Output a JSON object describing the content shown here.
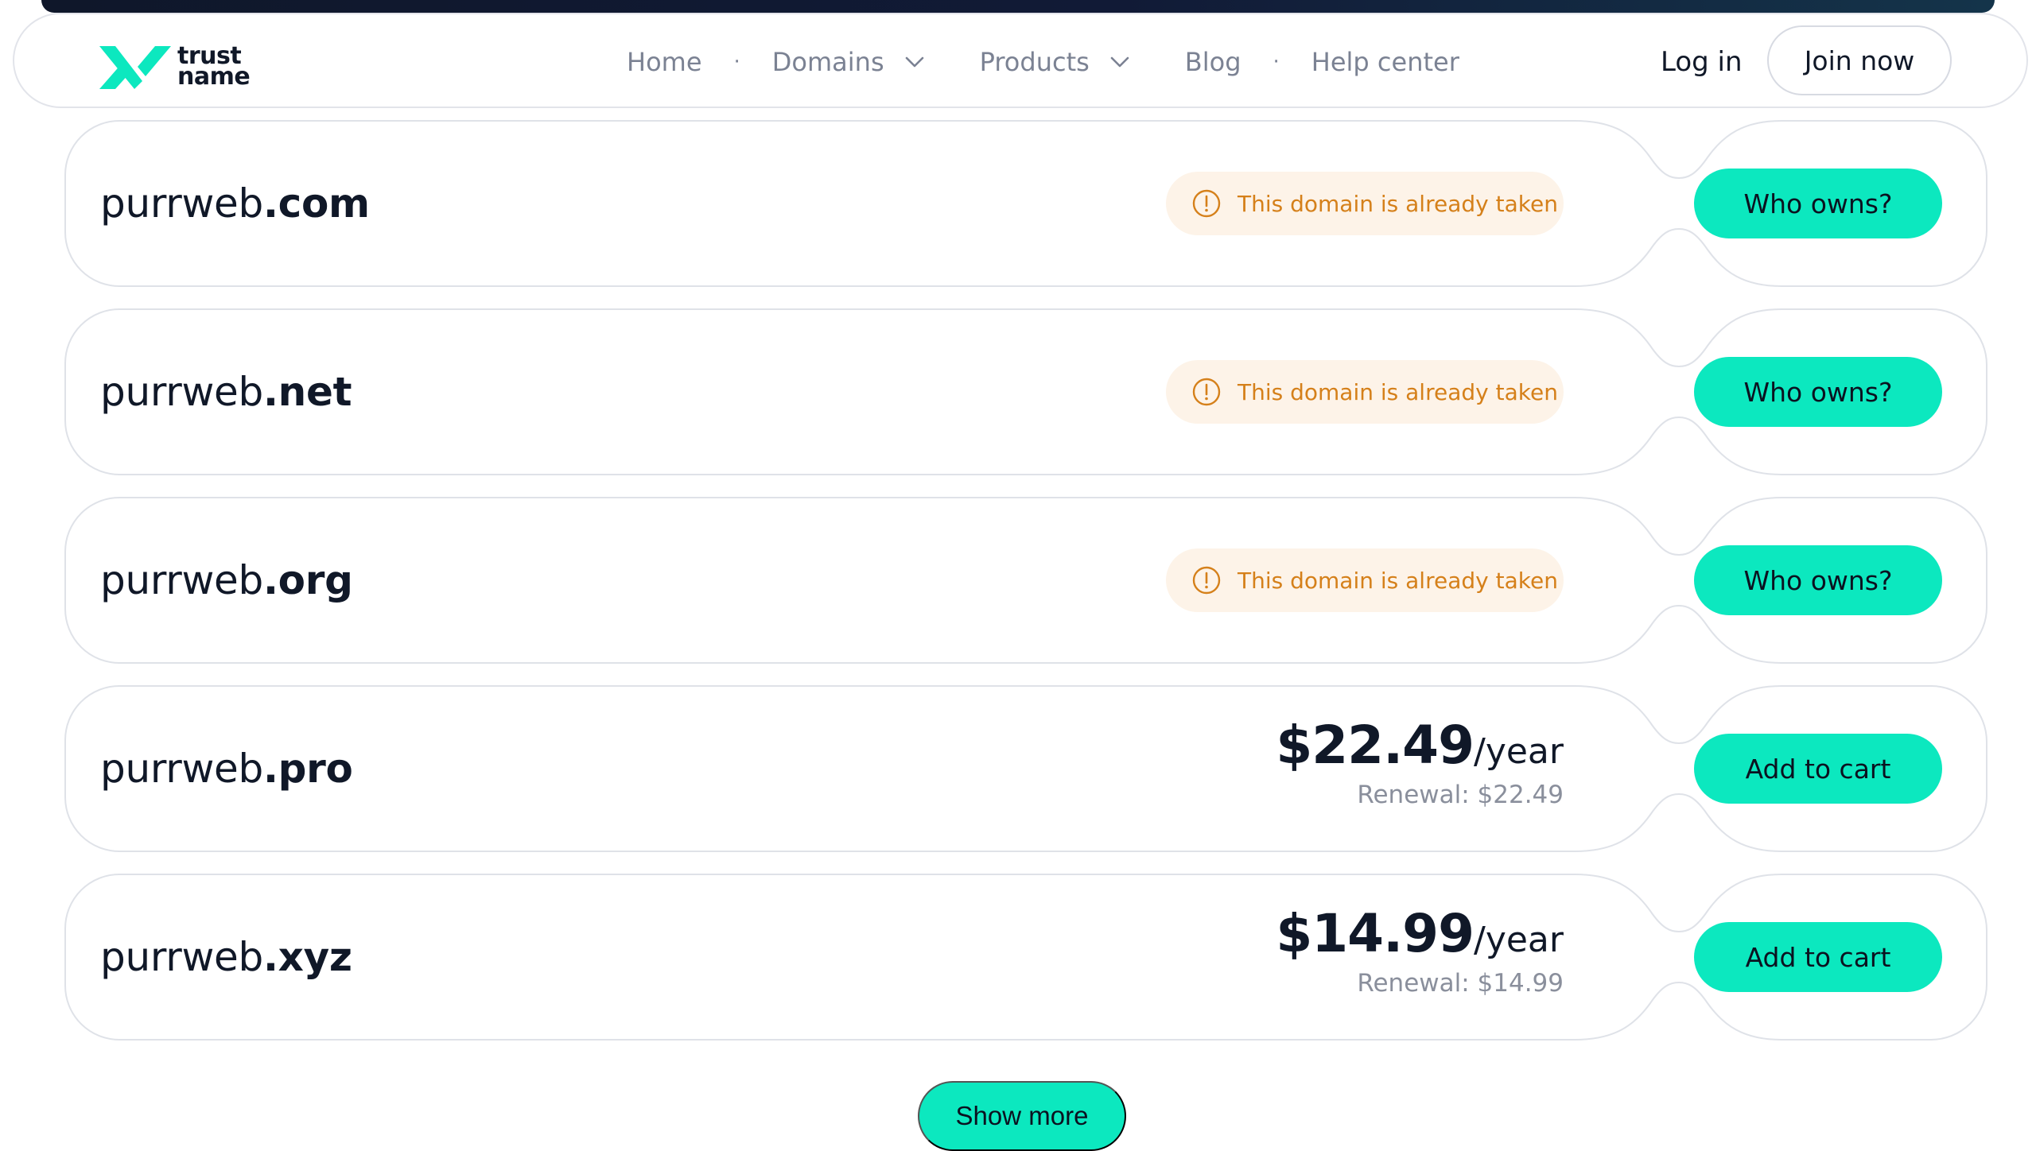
{
  "brand": {
    "line1": "trust",
    "line2": "name",
    "accent": "#0ce8bf"
  },
  "nav": {
    "home": "Home",
    "domains": "Domains",
    "products": "Products",
    "blog": "Blog",
    "help": "Help center",
    "separator": "·"
  },
  "auth": {
    "login": "Log in",
    "join": "Join now"
  },
  "results": [
    {
      "name": "purrweb",
      "tld": ".com",
      "status": "This domain is already taken",
      "action": "Who owns?"
    },
    {
      "name": "purrweb",
      "tld": ".net",
      "status": "This domain is already taken",
      "action": "Who owns?"
    },
    {
      "name": "purrweb",
      "tld": ".org",
      "status": "This domain is already taken",
      "action": "Who owns?"
    },
    {
      "name": "purrweb",
      "tld": ".pro",
      "price": "$22.49",
      "unit": "/year",
      "renewal": "Renewal: $22.49",
      "action": "Add to cart"
    },
    {
      "name": "purrweb",
      "tld": ".xyz",
      "price": "$14.99",
      "unit": "/year",
      "renewal": "Renewal: $14.99",
      "action": "Add to cart"
    }
  ],
  "show_more": "Show more"
}
